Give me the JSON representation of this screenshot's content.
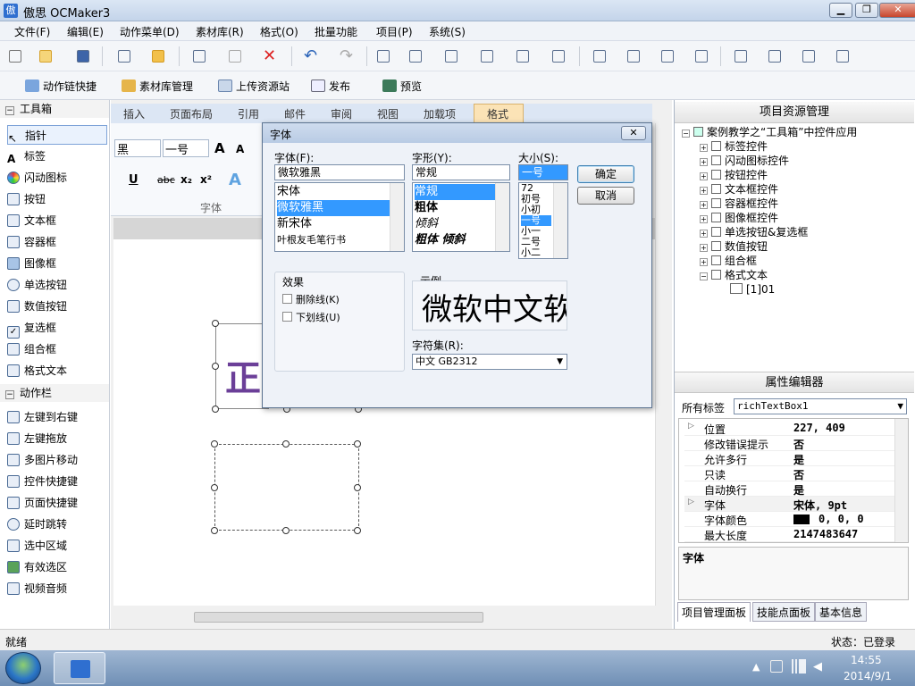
{
  "window": {
    "title": "傲思 OCMaker3",
    "icon_label": "傲"
  },
  "menu": [
    "文件(F)",
    "编辑(E)",
    "动作菜单(D)",
    "素材库(R)",
    "格式(O)",
    "批量功能",
    "项目(P)",
    "系统(S)"
  ],
  "quickbar": [
    "动作链快捷",
    "素材库管理",
    "上传资源站",
    "发布",
    "预览"
  ],
  "toolbox": {
    "sections": [
      {
        "label": "工具箱"
      },
      {
        "label": "动作栏"
      }
    ],
    "tools": [
      "指针",
      "标签",
      "闪动图标",
      "按钮",
      "文本框",
      "容器框",
      "图像框",
      "单选按钮",
      "数值按钮",
      "复选框",
      "组合框",
      "格式文本"
    ],
    "actions": [
      "左键到右键",
      "左键拖放",
      "多图片移动",
      "控件快捷键",
      "页面快捷键",
      "延时跳转",
      "选中区域",
      "有效选区",
      "视频音频"
    ]
  },
  "ribbon": {
    "tabs": [
      "插入",
      "页面布局",
      "引用",
      "邮件",
      "审阅",
      "视图",
      "加载项",
      "格式"
    ],
    "font_name": "黑",
    "font_size": "一号",
    "group_label": "字体",
    "grow": "A",
    "shrink": "A",
    "underline": "U",
    "strike": "abc",
    "sub": "x₂",
    "sup": "x²",
    "effect": "A"
  },
  "canvas": {
    "preview_text": "正"
  },
  "project_panel": {
    "title": "项目资源管理",
    "root": "案例教学之“工具箱”中控件应用",
    "items": [
      "标签控件",
      "闪动图标控件",
      "按钮控件",
      "文本框控件",
      "容器框控件",
      "图像框控件",
      "单选按钮&复选框",
      "数值按钮",
      "组合框",
      "格式文本"
    ],
    "leaf": "[1]01"
  },
  "property_panel": {
    "title": "属性编辑器",
    "filter_label": "所有标签",
    "selected_object": "richTextBox1",
    "rows": [
      {
        "name": "位置",
        "value": "227, 409",
        "expand": "▷"
      },
      {
        "name": "修改错误提示",
        "value": "否"
      },
      {
        "name": "允许多行",
        "value": "是"
      },
      {
        "name": "只读",
        "value": "否"
      },
      {
        "name": "自动换行",
        "value": "是"
      },
      {
        "name": "字体",
        "value": "宋体, 9pt",
        "expand": "▷"
      },
      {
        "name": "字体颜色",
        "value": "0, 0, 0",
        "swatch": "#000000"
      },
      {
        "name": "最大长度",
        "value": "2147483647"
      }
    ],
    "description_title": "字体"
  },
  "bottom_tabs": [
    "项目管理面板",
    "技能点面板",
    "基本信息"
  ],
  "status": {
    "left": "就绪",
    "right": "状态：已登录"
  },
  "taskbar": {
    "time": "14:55",
    "date": "2014/9/1"
  },
  "font_dialog": {
    "title": "字体",
    "close": "✕",
    "font_label": "字体(F):",
    "font_value": "微软雅黑",
    "fonts": [
      "宋体",
      "微软雅黑",
      "新宋体",
      "叶根友毛笔行书"
    ],
    "font_selected": 1,
    "style_label": "字形(Y):",
    "style_value": "常规",
    "styles": [
      "常规",
      "粗体",
      "倾斜",
      "粗体 倾斜"
    ],
    "style_selected": 0,
    "size_label": "大小(S):",
    "size_value": "一号",
    "sizes": [
      "72",
      "初号",
      "小初",
      "一号",
      "小一",
      "二号",
      "小二"
    ],
    "size_selected": 3,
    "ok": "确定",
    "cancel": "取消",
    "effects_label": "效果",
    "strike_label": "删除线(K)",
    "underline_label": "下划线(U)",
    "sample_label": "示例",
    "sample_text": "微软中文软",
    "charset_label": "字符集(R):",
    "charset_value": "中文 GB2312"
  }
}
